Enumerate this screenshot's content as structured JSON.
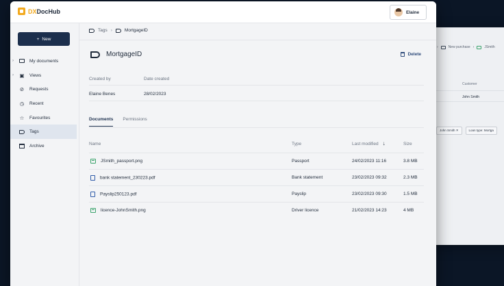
{
  "background_window": {
    "breadcrumb": [
      "New purchase",
      "JSmith"
    ],
    "column_header": "Customer",
    "column_value": "John Smith",
    "chips": [
      "John Smith",
      "Loan type: Mortga"
    ]
  },
  "app": {
    "logo_prefix": "DX",
    "logo_name": "DocHub"
  },
  "user": {
    "name": "Elaine"
  },
  "sidebar": {
    "new_label": "New",
    "items": [
      {
        "label": "My documents",
        "icon": "folder-icon",
        "expandable": true
      },
      {
        "label": "Views",
        "icon": "views-icon",
        "expandable": true
      },
      {
        "label": "Requests",
        "icon": "requests-icon",
        "expandable": false
      },
      {
        "label": "Recent",
        "icon": "clock-icon",
        "expandable": false
      },
      {
        "label": "Favourites",
        "icon": "star-icon",
        "expandable": false
      },
      {
        "label": "Tags",
        "icon": "tag-icon",
        "expandable": false,
        "active": true
      },
      {
        "label": "Archive",
        "icon": "archive-icon",
        "expandable": false
      }
    ]
  },
  "breadcrumb": {
    "root": "Tags",
    "current": "MortgageID"
  },
  "page": {
    "title": "MortgageID",
    "delete_label": "Delete",
    "meta_headers": [
      "Created by",
      "Date created"
    ],
    "meta_values": [
      "Elaine Benes",
      "28/02/2023"
    ]
  },
  "tabs": [
    {
      "label": "Documents",
      "active": true
    },
    {
      "label": "Permissions",
      "active": false
    }
  ],
  "table": {
    "columns": [
      "Name",
      "Type",
      "Last modified",
      "Size"
    ],
    "sorted_column": "Last modified",
    "rows": [
      {
        "name": "JSmith_passport.png",
        "type": "Passport",
        "modified": "24/02/2023 11:16",
        "size": "3.8 MB",
        "icon": "image-file-icon"
      },
      {
        "name": "bank statement_230223.pdf",
        "type": "Bank statement",
        "modified": "23/02/2023 09:32",
        "size": "2.3 MB",
        "icon": "document-file-icon"
      },
      {
        "name": "Payslip250123.pdf",
        "type": "Payslip",
        "modified": "23/02/2023 09:30",
        "size": "1.5 MB",
        "icon": "document-file-icon"
      },
      {
        "name": "licence-JohnSmith.png",
        "type": "Driver licence",
        "modified": "21/02/2023 14:23",
        "size": "4 MB",
        "icon": "image-file-icon"
      }
    ]
  },
  "colors": {
    "accent": "#1c2f4d",
    "logo": "#f2a91e",
    "image_file": "#3aa36b",
    "doc_file": "#2d5aa8",
    "backdrop": "#0b1626"
  }
}
